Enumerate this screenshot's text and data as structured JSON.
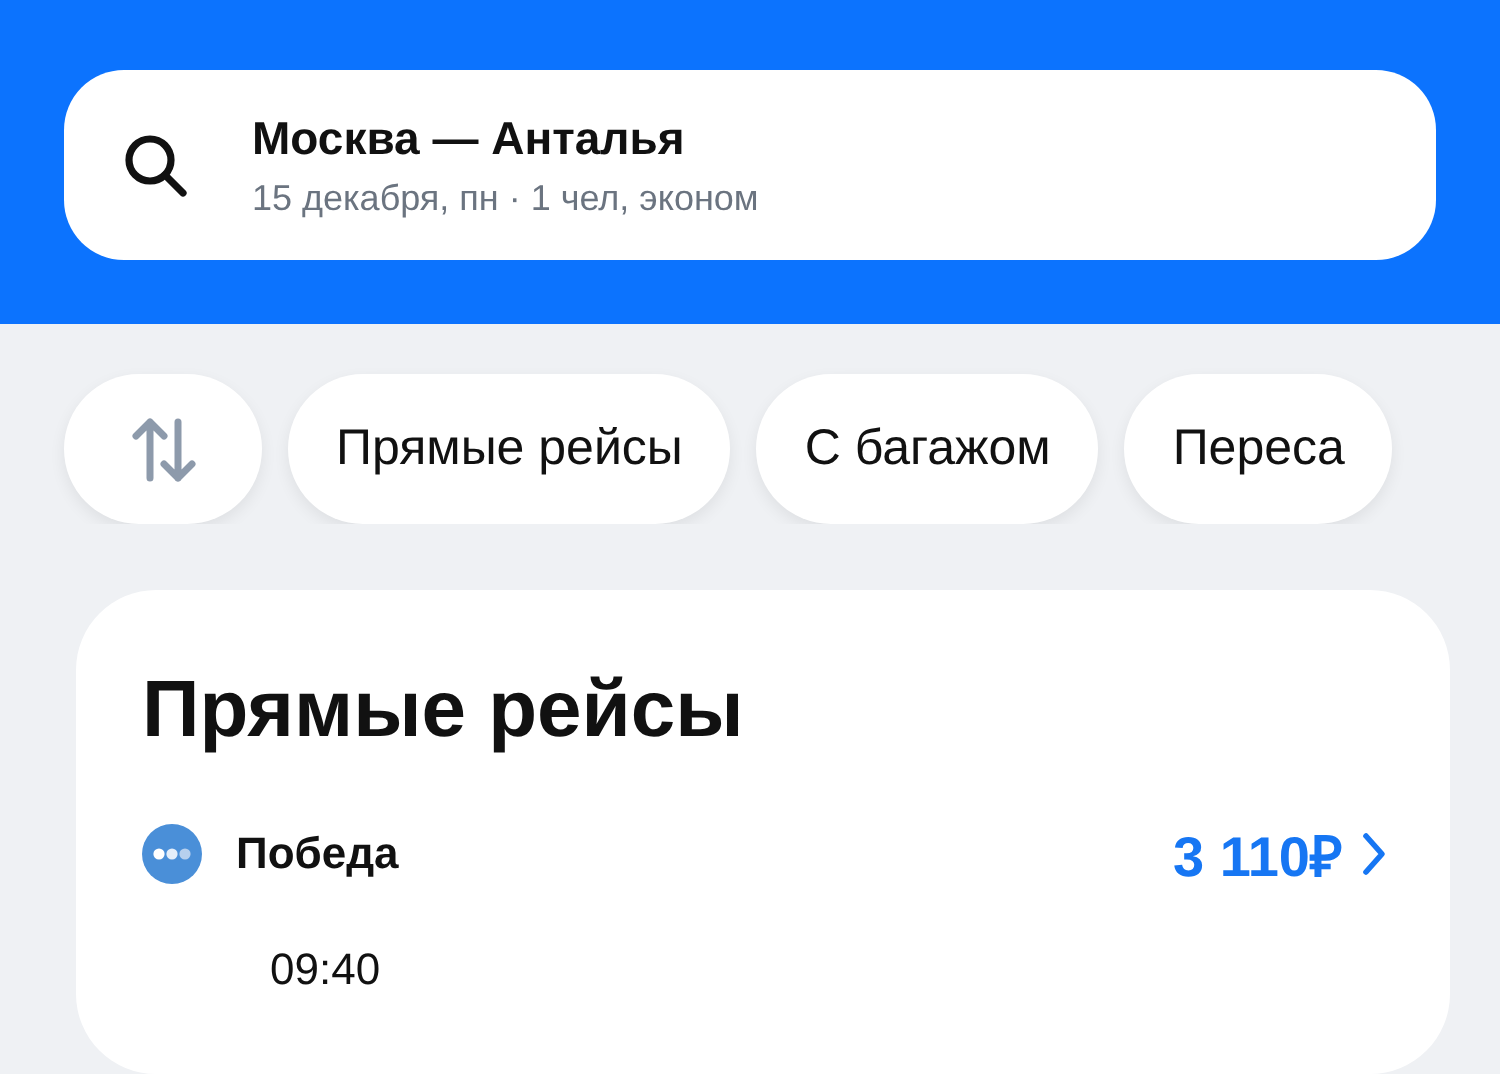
{
  "search": {
    "route": "Москва — Анталья",
    "details": "15 декабря, пн · 1 чел, эконом"
  },
  "filters": [
    "Прямые рейсы",
    "С багажом",
    "Переса"
  ],
  "section": {
    "title": "Прямые рейсы",
    "flights": [
      {
        "airline": "Победа",
        "price": "3 110₽",
        "time": "09:40"
      }
    ]
  }
}
